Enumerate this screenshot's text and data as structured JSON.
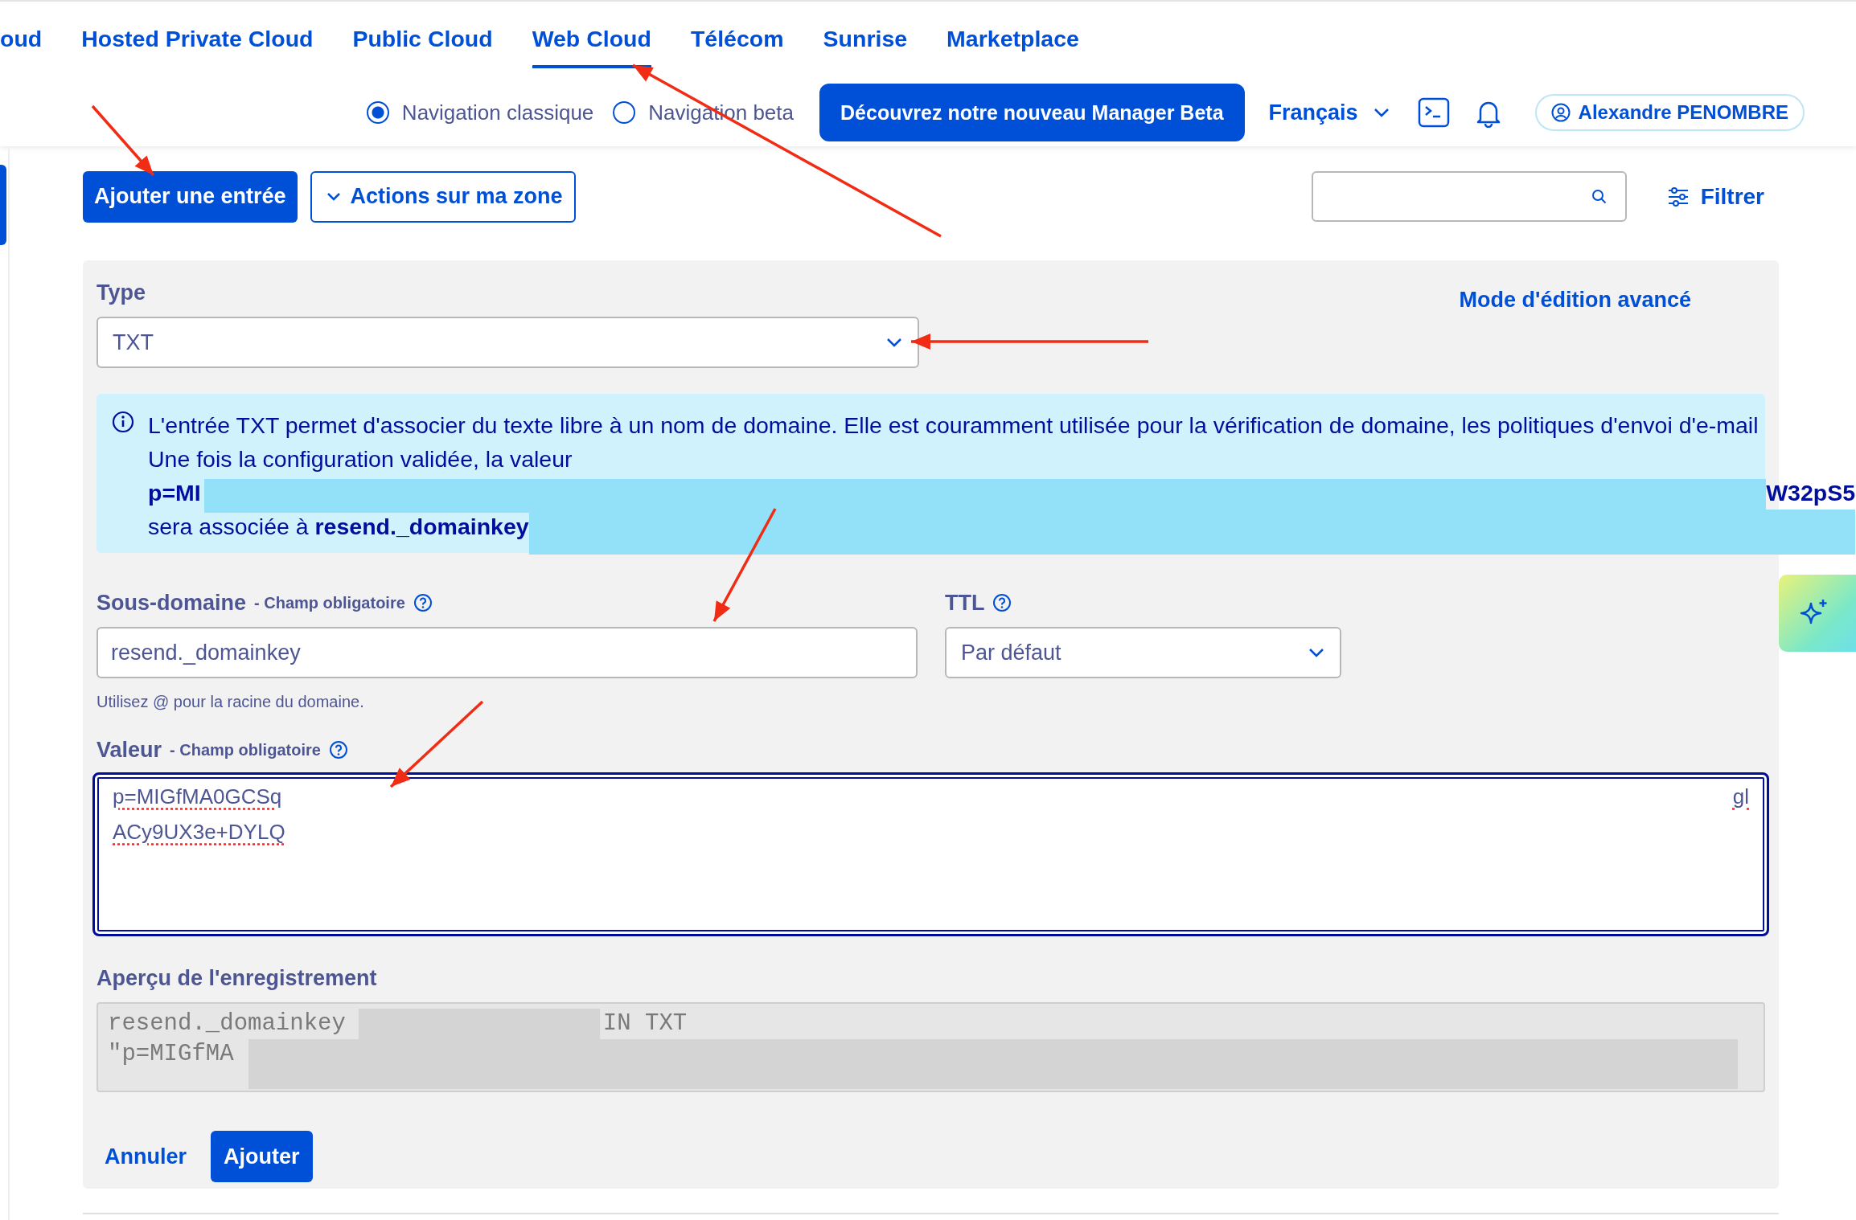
{
  "top_nav": {
    "tabs": [
      {
        "label": "oud",
        "selected": false
      },
      {
        "label": "Hosted Private Cloud",
        "selected": false
      },
      {
        "label": "Public Cloud",
        "selected": false
      },
      {
        "label": "Web Cloud",
        "selected": true
      },
      {
        "label": "Télécom",
        "selected": false
      },
      {
        "label": "Sunrise",
        "selected": false
      },
      {
        "label": "Marketplace",
        "selected": false
      }
    ]
  },
  "nav_mode": [
    {
      "label": "Navigation classique",
      "selected": true
    },
    {
      "label": "Navigation beta",
      "selected": false
    }
  ],
  "beta_button": "Découvrez notre nouveau Manager Beta",
  "language": "Français",
  "user": "Alexandre PENOMBRE",
  "toolbar": {
    "add_button": "Ajouter une entrée",
    "actions_button": "Actions sur ma zone",
    "filter_button": "Filtrer"
  },
  "form": {
    "type_label": "Type",
    "type_value": "TXT",
    "advanced_mode_link": "Mode d'édition avancé",
    "info": {
      "line_1": "L'entrée TXT permet d'associer du texte libre à un nom de domaine. Elle est couramment utilisée pour la vérification de domaine, les politiques d'envoi d'e-mail",
      "line_2": "Une fois la configuration validée, la valeur",
      "value_start": "p=MI",
      "value_end": "W32pS5",
      "line_4": "sera associée à **resend._domainkey**"
    },
    "subdomain": {
      "label": "Sous-domaine",
      "required": "- Champ obligatoire",
      "value": "resend._domainkey",
      "hint": "Utilisez @ pour la racine du domaine."
    },
    "ttl": {
      "label": "TTL",
      "value": "Par défaut"
    },
    "value_field": {
      "label": "Valeur",
      "required": "- Champ obligatoire",
      "lines": [
        "p=MIGfMA0GCSq",
        "ACy9UX3e+DYLQ"
      ],
      "line_end": "gl"
    },
    "preview": {
      "label": "Aperçu de l'enregistrement",
      "line_1_start": "resend._domainkey",
      "line_1_end": "IN TXT",
      "line_2": "\"p=MIGfMA"
    },
    "cancel": "Annuler",
    "submit": "Ajouter"
  }
}
